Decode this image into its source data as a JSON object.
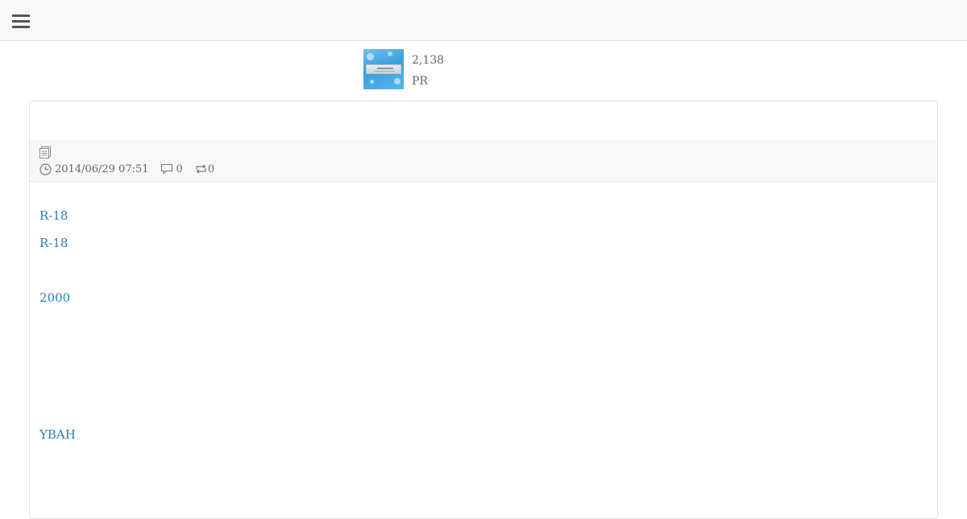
{
  "header": {
    "menu_icon": "hamburger-menu-icon"
  },
  "profile": {
    "count": "2,138",
    "pr_label": "PR"
  },
  "post": {
    "type_icon": "document-icon",
    "date": "2014/06/29 07:51",
    "comments": "0",
    "reblogs": "0",
    "links": [
      "R-18",
      "R-18",
      "2000",
      "YBAH"
    ]
  },
  "colors": {
    "link": "#2f7bb8",
    "header_bg": "#f7f7f7",
    "meta_bg": "#f7f7f7"
  }
}
